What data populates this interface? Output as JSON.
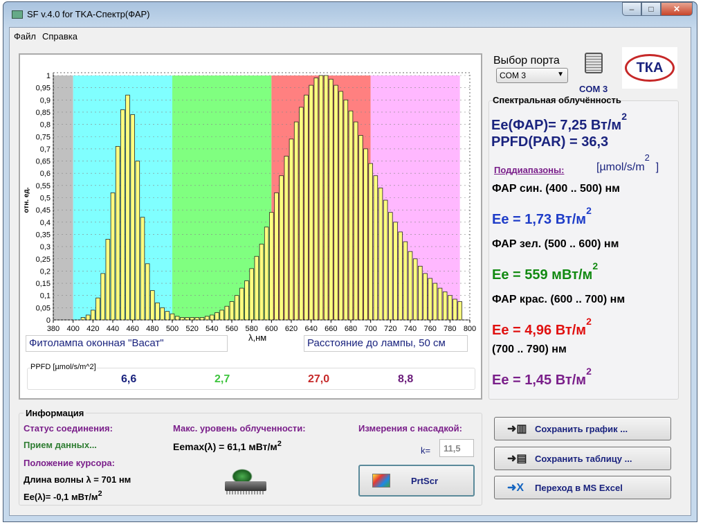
{
  "window": {
    "title": "SF v.4.0 for TKA-Спектр(ФАР)",
    "minimize": "–",
    "maximize": "□",
    "close": "✕"
  },
  "menu": {
    "items": [
      {
        "label": "Файл",
        "accel": "Ф"
      },
      {
        "label": "Справка",
        "accel": "С"
      }
    ]
  },
  "chart_data": {
    "type": "bar",
    "ylabel": "отн. ед.",
    "xlabel": "λ,нм",
    "xlim": [
      380,
      800
    ],
    "ylim": [
      0,
      1
    ],
    "grid": true,
    "x_ticks": [
      380,
      400,
      420,
      440,
      460,
      480,
      500,
      520,
      540,
      560,
      580,
      600,
      620,
      640,
      660,
      680,
      700,
      720,
      740,
      760,
      780,
      800
    ],
    "y_ticks": [
      "0",
      "0,05",
      "0,1",
      "0,15",
      "0,2",
      "0,25",
      "0,3",
      "0,35",
      "0,4",
      "0,45",
      "0,5",
      "0,55",
      "0,6",
      "0,65",
      "0,7",
      "0,75",
      "0,8",
      "0,85",
      "0,9",
      "0,95",
      "1"
    ],
    "bands": [
      {
        "from": 380,
        "to": 400,
        "color": "#c0c0c0"
      },
      {
        "from": 400,
        "to": 500,
        "color": "#80ffff"
      },
      {
        "from": 500,
        "to": 600,
        "color": "#80ff80"
      },
      {
        "from": 600,
        "to": 700,
        "color": "#ff8080"
      },
      {
        "from": 700,
        "to": 790,
        "color": "#ffb8ff"
      }
    ],
    "bar_color": "#ffff80",
    "x_start": 400,
    "x_step": 5,
    "values": [
      0,
      0,
      0.01,
      0.02,
      0.04,
      0.09,
      0.19,
      0.33,
      0.52,
      0.71,
      0.86,
      0.92,
      0.84,
      0.65,
      0.42,
      0.23,
      0.12,
      0.07,
      0.05,
      0.035,
      0.025,
      0.015,
      0.01,
      0.01,
      0.01,
      0.01,
      0.01,
      0.015,
      0.02,
      0.03,
      0.04,
      0.056,
      0.075,
      0.1,
      0.13,
      0.16,
      0.21,
      0.26,
      0.31,
      0.38,
      0.44,
      0.52,
      0.59,
      0.67,
      0.74,
      0.81,
      0.87,
      0.92,
      0.96,
      0.99,
      1.0,
      1.0,
      0.985,
      0.96,
      0.935,
      0.9,
      0.855,
      0.81,
      0.755,
      0.7,
      0.64,
      0.59,
      0.54,
      0.49,
      0.44,
      0.4,
      0.36,
      0.32,
      0.28,
      0.25,
      0.22,
      0.19,
      0.17,
      0.15,
      0.13,
      0.115,
      0.1,
      0.085,
      0.075
    ]
  },
  "chart_panel": {
    "lamp_name": "Фитолампа оконная \"Васат\"",
    "distance": "Расстояние до лампы, 50 см",
    "ppfd_label": "PPFD [µmol/s/m^2]",
    "ppfd_values": [
      {
        "v": "6,6",
        "color": "#1a237e"
      },
      {
        "v": "2,7",
        "color": "#3ec43e"
      },
      {
        "v": "27,0",
        "color": "#c62828"
      },
      {
        "v": "8,8",
        "color": "#6a1b7a"
      }
    ]
  },
  "port": {
    "label": "Выбор порта",
    "selected": "COM 3",
    "status": "COM  3"
  },
  "logo": {
    "text": "ТКА"
  },
  "irradiance": {
    "title": "Спектральная облучённость",
    "ee_par": "Ee(ФАР)= 7,25 Вт/м",
    "sup": "2",
    "ppfd": "PPFD(PAR) = 36,3",
    "ppfd_unit": "[µmol/s/m",
    "ppfd_unit_end": "]",
    "subranges_label": "Поддиапазоны:",
    "ranges": [
      {
        "label": "ФАР син. (400 .. 500) нм",
        "value": "Ee = 1,73 Вт/м",
        "color": "#1e3cc8"
      },
      {
        "label": "ФАР зел. (500 .. 600) нм",
        "value": "Ee = 559 мВт/м",
        "color": "#128a12"
      },
      {
        "label": "ФАР крас. (600 .. 700) нм",
        "value": "Ee = 4,96 Вт/м",
        "color": "#e01010"
      },
      {
        "label": "(700 .. 790) нм",
        "value": "Ee = 1,45 Вт/м",
        "color": "#7a1f8a"
      }
    ]
  },
  "info": {
    "title": "Информация",
    "status_label": "Статус соединения:",
    "status_value": "Прием данных...",
    "cursor_label": "Положение курсора:",
    "wavelength": "Длина волны λ   = 701 нм",
    "ee_cursor": "Ee(λ)= -0,1 мВт/м",
    "max_label": "Макс. уровень облученности:",
    "max_value": "Eemax(λ) = 61,1 мВт/м",
    "nozzle_label": "Измерения с насадкой:",
    "k_label": "k=",
    "k_value": "11,5",
    "prtscr": "PrtScr"
  },
  "buttons": {
    "save_chart": "Сохранить график ...",
    "save_table": "Сохранить таблицу ...",
    "excel": "Переход в MS Excel"
  }
}
